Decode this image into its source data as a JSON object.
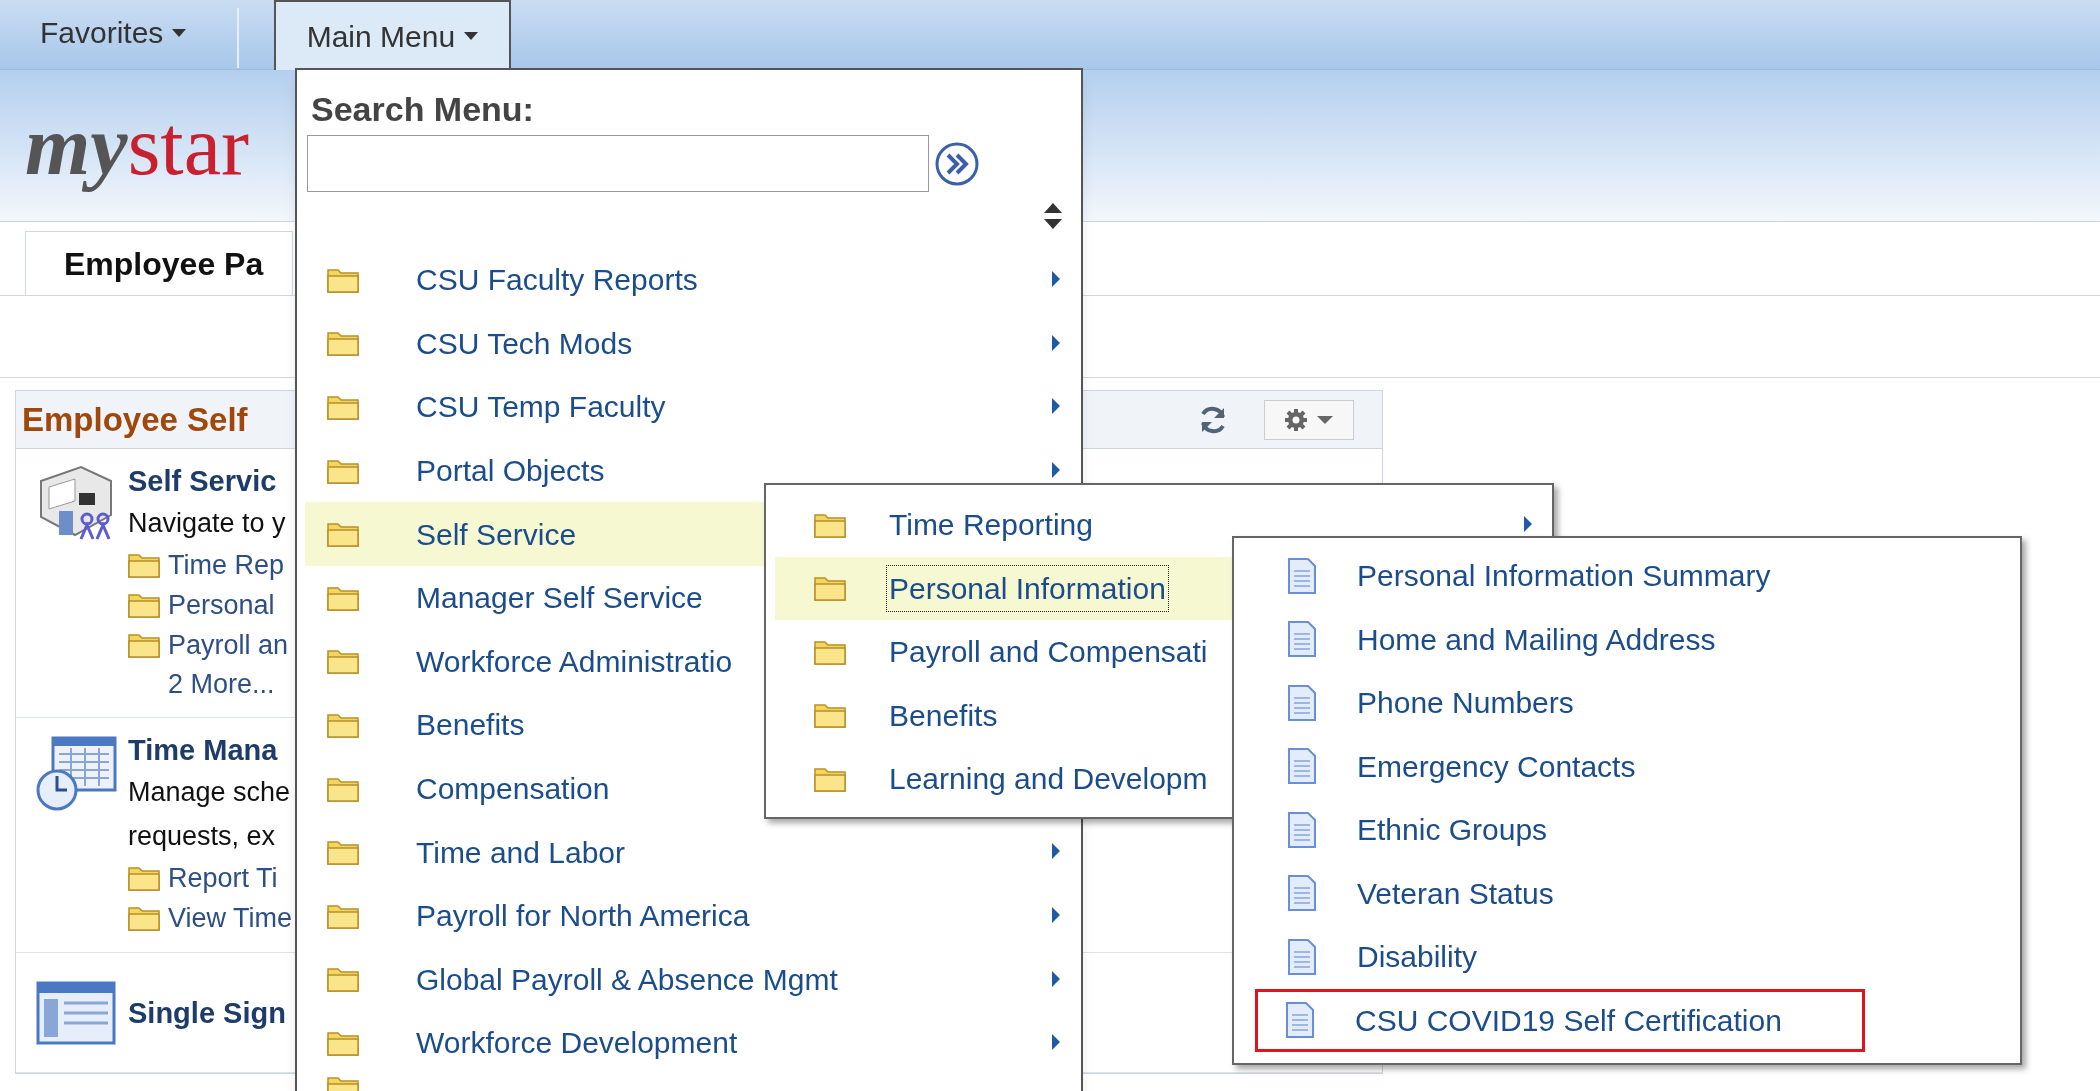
{
  "nav": {
    "favorites": "Favorites",
    "main_menu": "Main Menu"
  },
  "logo": {
    "first": "my",
    "second": "star"
  },
  "page_tab": "Employee Pa",
  "pagelet": {
    "title": "Employee Self",
    "sections": [
      {
        "kind": "people",
        "title": "Self Servic",
        "description": [
          "Navigate to y"
        ],
        "links": [
          "Time Rep",
          "Personal",
          "Payroll an"
        ],
        "more": "2 More..."
      },
      {
        "kind": "calendar",
        "title": "Time Mana",
        "description": [
          "Manage sche",
          "requests, ex"
        ],
        "links": [
          "Report Ti",
          "View Time"
        ]
      },
      {
        "kind": "window",
        "title": "Single Sign"
      }
    ]
  },
  "main_menu": {
    "search_label": "Search Menu:",
    "items": [
      {
        "label": "CSU Faculty Reports",
        "selected": false,
        "arrow": true
      },
      {
        "label": "CSU Tech Mods",
        "selected": false,
        "arrow": true
      },
      {
        "label": "CSU Temp Faculty",
        "selected": false,
        "arrow": true
      },
      {
        "label": "Portal Objects",
        "selected": false,
        "arrow": true
      },
      {
        "label": "Self Service",
        "selected": true
      },
      {
        "label": "Manager Self Service",
        "selected": false
      },
      {
        "label": "Workforce Administratio",
        "selected": false
      },
      {
        "label": "Benefits",
        "selected": false
      },
      {
        "label": "Compensation",
        "selected": false
      },
      {
        "label": "Time and Labor",
        "selected": false,
        "arrow": true
      },
      {
        "label": "Payroll for North America",
        "selected": false,
        "arrow": true
      },
      {
        "label": "Global Payroll & Absence Mgmt",
        "selected": false,
        "arrow": true
      },
      {
        "label": "Workforce Development",
        "selected": false,
        "arrow": true
      }
    ]
  },
  "submenu": {
    "items": [
      {
        "label": "Time Reporting",
        "selected": false,
        "arrow": true
      },
      {
        "label": "Personal Information",
        "selected": true
      },
      {
        "label": "Payroll and Compensati",
        "selected": false
      },
      {
        "label": "Benefits",
        "selected": false
      },
      {
        "label": "Learning and Developm",
        "selected": false
      }
    ]
  },
  "pages_menu": {
    "items": [
      {
        "label": "Personal Information Summary",
        "highlighted": false
      },
      {
        "label": "Home and Mailing Address",
        "highlighted": false
      },
      {
        "label": "Phone Numbers",
        "highlighted": false
      },
      {
        "label": "Emergency Contacts",
        "highlighted": false
      },
      {
        "label": "Ethnic Groups",
        "highlighted": false
      },
      {
        "label": "Veteran Status",
        "highlighted": false
      },
      {
        "label": "Disability",
        "highlighted": false
      },
      {
        "label": "CSU COVID19 Self Certification",
        "highlighted": true
      }
    ]
  }
}
